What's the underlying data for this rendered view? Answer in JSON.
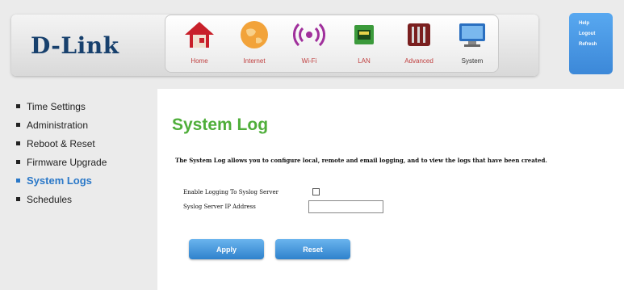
{
  "brand": {
    "logo_text": "D-Link"
  },
  "nav": {
    "items": [
      {
        "label": "Home",
        "icon": "home-icon"
      },
      {
        "label": "Internet",
        "icon": "globe-icon"
      },
      {
        "label": "Wi-Fi",
        "icon": "wifi-icon"
      },
      {
        "label": "LAN",
        "icon": "lan-port-icon"
      },
      {
        "label": "Advanced",
        "icon": "tools-icon"
      },
      {
        "label": "System",
        "icon": "monitor-icon"
      }
    ],
    "active": "System"
  },
  "helpbox": {
    "help": "Help",
    "logout": "Logout",
    "refresh": "Refresh"
  },
  "sidebar": {
    "items": [
      {
        "label": "Time Settings"
      },
      {
        "label": "Administration"
      },
      {
        "label": "Reboot & Reset"
      },
      {
        "label": "Firmware Upgrade"
      },
      {
        "label": "System Logs"
      },
      {
        "label": "Schedules"
      }
    ],
    "active": "System Logs"
  },
  "main": {
    "title": "System Log",
    "description": "The System Log allows you to configure local, remote and email logging, and to view the logs that have been created.",
    "enable_logging_label": "Enable Logging To Syslog Server",
    "enable_logging_checked": false,
    "syslog_ip_label": "Syslog Server IP Address",
    "syslog_ip_value": "",
    "apply_label": "Apply",
    "reset_label": "Reset"
  },
  "colors": {
    "brand": "#17406d",
    "title_green": "#4fae3a",
    "accent_blue": "#2a78c8",
    "nav_label_red": "#c04040"
  }
}
